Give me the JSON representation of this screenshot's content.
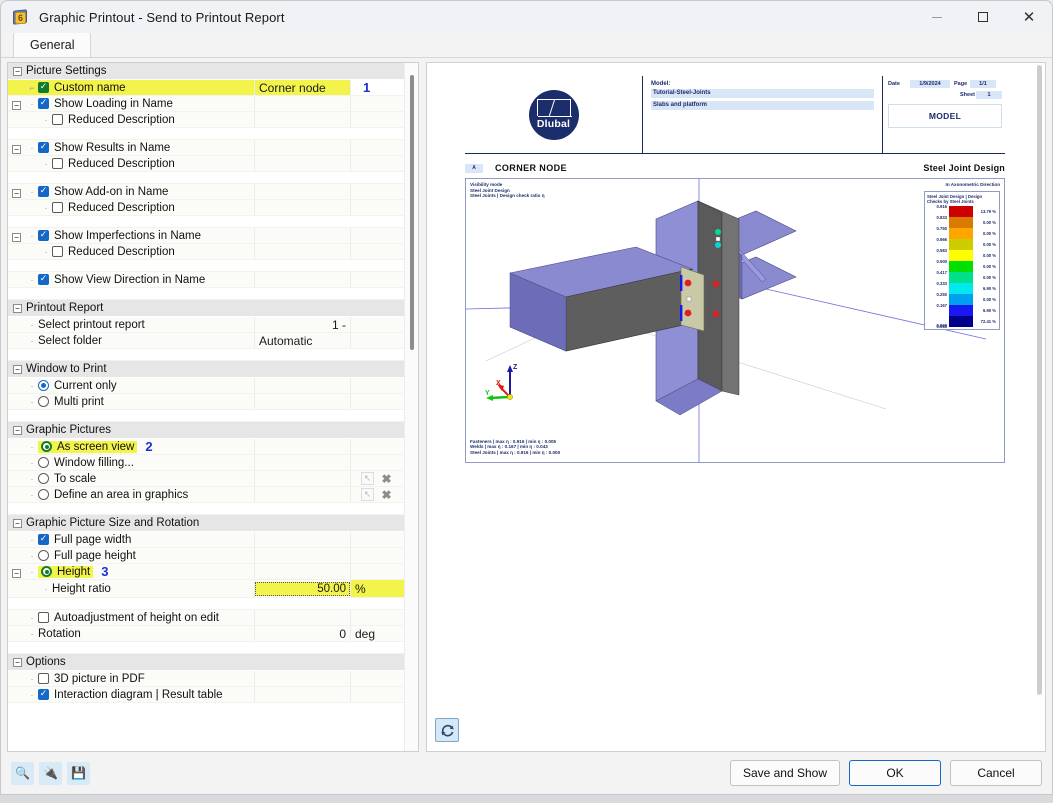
{
  "window": {
    "title": "Graphic Printout - Send to Printout Report",
    "app_icon": "printout-icon",
    "minimize": "–",
    "maximize": "□",
    "close": "✕"
  },
  "tabs": [
    {
      "label": "General",
      "active": true
    }
  ],
  "sections": {
    "picture_settings": {
      "title": "Picture Settings",
      "rows": [
        {
          "label": "Custom name",
          "control": "checkbox",
          "checked": true,
          "accent": "green",
          "value": "Corner node",
          "highlight": true,
          "marker": "1",
          "indent": 1
        },
        {
          "label": "Show Loading in Name",
          "control": "checkbox",
          "checked": true,
          "indent": 1,
          "expander": true
        },
        {
          "label": "Reduced Description",
          "control": "checkbox",
          "checked": false,
          "indent": 2
        },
        {
          "label": "Show Results in Name",
          "control": "checkbox",
          "checked": true,
          "indent": 1,
          "expander": true
        },
        {
          "label": "Reduced Description",
          "control": "checkbox",
          "checked": false,
          "indent": 2
        },
        {
          "label": "Show Add-on in Name",
          "control": "checkbox",
          "checked": true,
          "indent": 1,
          "expander": true
        },
        {
          "label": "Reduced Description",
          "control": "checkbox",
          "checked": false,
          "indent": 2
        },
        {
          "label": "Show Imperfections in Name",
          "control": "checkbox",
          "checked": true,
          "indent": 1,
          "expander": true
        },
        {
          "label": "Reduced Description",
          "control": "checkbox",
          "checked": false,
          "indent": 2
        },
        {
          "label": "Show View Direction in Name",
          "control": "checkbox",
          "checked": true,
          "indent": 1
        }
      ]
    },
    "printout_report": {
      "title": "Printout Report",
      "rows": [
        {
          "label": "Select printout report",
          "value": "1 -"
        },
        {
          "label": "Select folder",
          "value": "Automatic"
        }
      ]
    },
    "window_to_print": {
      "title": "Window to Print",
      "rows": [
        {
          "label": "Current only",
          "control": "radio",
          "checked": true
        },
        {
          "label": "Multi print",
          "control": "radio",
          "checked": false
        }
      ]
    },
    "graphic_pictures": {
      "title": "Graphic Pictures",
      "rows": [
        {
          "label": "As screen view",
          "control": "radio",
          "checked": true,
          "accent": "green",
          "highlight": true,
          "marker": "2"
        },
        {
          "label": "Window filling...",
          "control": "radio",
          "checked": false
        },
        {
          "label": "To scale",
          "control": "radio",
          "checked": false,
          "icons": [
            "pick-icon",
            "delete-icon"
          ]
        },
        {
          "label": "Define an area in graphics",
          "control": "radio",
          "checked": false,
          "icons": [
            "pick-icon",
            "delete-icon"
          ]
        }
      ]
    },
    "size_rotation": {
      "title": "Graphic Picture Size and Rotation",
      "rows": [
        {
          "label": "Full page width",
          "control": "checkbox",
          "checked": true
        },
        {
          "label": "Full page height",
          "control": "radio",
          "checked": false
        },
        {
          "label": "Height",
          "control": "radio",
          "checked": true,
          "accent": "green",
          "highlight": true,
          "marker": "3",
          "expander": true
        },
        {
          "label": "Height ratio",
          "control": "none",
          "value": "50.00",
          "unit": "%",
          "highlight": true,
          "editable": true,
          "indent": 2
        },
        {
          "label": "Autoadjustment of height on edit",
          "control": "checkbox",
          "checked": false
        },
        {
          "label": "Rotation",
          "control": "none",
          "value": "0",
          "unit": "deg"
        }
      ]
    },
    "options": {
      "title": "Options",
      "rows": [
        {
          "label": "3D picture in PDF",
          "control": "checkbox",
          "checked": false
        },
        {
          "label": "Interaction diagram | Result table",
          "control": "checkbox",
          "checked": true
        }
      ]
    }
  },
  "preview": {
    "logo_name": "Dlubal",
    "header": {
      "model_key": "Model:",
      "model_name": "Tutorial-Steel-Joints",
      "model_sub": "Slabs and platform",
      "date_label": "Date",
      "date_value": "1/9/2024",
      "page_label": "Page",
      "page_value": "1/1",
      "sheet_label": "Sheet",
      "sheet_value": "1",
      "model_box": "MODEL"
    },
    "chip": "A",
    "doc_title": "CORNER NODE",
    "doc_title_right": "Steel Joint Design",
    "viewport": {
      "top_left": [
        "Visibility mode",
        "Steel Joint Design",
        "Steel Joints | Design check ratio η"
      ],
      "top_right": "In Axonometric Direction",
      "bottom_left": [
        "Fasteners | max η : 0.916 | min η : 0.005",
        "Welds | max η : 0.167 | min η : 0.043",
        "Steel Joints | max η : 0.916 | min η : 0.000"
      ],
      "axis_labels": {
        "x": "X",
        "y": "Y",
        "z": "Z"
      }
    },
    "legend": {
      "title_line1": "Steel Joint Design | Design",
      "title_line2": "Checks by Steel Joints",
      "entries": [
        {
          "tick": "0.916",
          "color": "#cc0000",
          "percent": "13.79 %"
        },
        {
          "tick": "0.833",
          "color": "#d97b00",
          "percent": "0.00 %"
        },
        {
          "tick": "0.750",
          "color": "#ffa500",
          "percent": "0.00 %"
        },
        {
          "tick": "0.666",
          "color": "#cccc00",
          "percent": "0.00 %"
        },
        {
          "tick": "0.583",
          "color": "#ffff00",
          "percent": "0.00 %"
        },
        {
          "tick": "0.500",
          "color": "#00e000",
          "percent": "0.00 %"
        },
        {
          "tick": "0.417",
          "color": "#00e08a",
          "percent": "0.00 %"
        },
        {
          "tick": "0.333",
          "color": "#00e8f0",
          "percent": "6.90 %"
        },
        {
          "tick": "0.250",
          "color": "#00a0f0",
          "percent": "0.00 %"
        },
        {
          "tick": "0.167",
          "color": "#1818f0",
          "percent": "6.90 %"
        },
        {
          "tick": "0.083",
          "color": "#00008b",
          "percent": "72.41 %"
        },
        {
          "tick": "0.000",
          "color": "",
          "percent": ""
        }
      ]
    },
    "refresh_button": "refresh-icon"
  },
  "footer": {
    "icons": [
      "help-icon",
      "connection-icon",
      "save-settings-icon"
    ],
    "buttons": [
      {
        "label": "Save and Show",
        "primary": false
      },
      {
        "label": "OK",
        "primary": true
      },
      {
        "label": "Cancel",
        "primary": false
      }
    ]
  }
}
